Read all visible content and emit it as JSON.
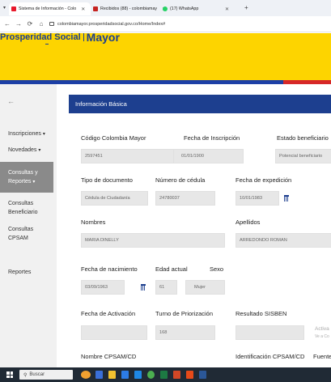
{
  "browser": {
    "tabs": [
      {
        "label": "Sistema de Información - Colo",
        "favicon_color": "#e8192c",
        "active": true
      },
      {
        "label": "Recibidos (88) - colombiamay",
        "favicon_color": "#c5221f",
        "active": false
      },
      {
        "label": "(17) WhatsApp",
        "favicon_color": "#25d366",
        "active": false
      }
    ],
    "tab_close": "✕",
    "new_tab": "+",
    "dropdown": "▾",
    "url": "colombiamayor.prosperidadsocial.gov.co/Home/Index#",
    "nav": {
      "back": "←",
      "forward": "→",
      "reload": "⟳",
      "home": "⌂"
    }
  },
  "header": {
    "brand_sub": "Prosperidad Social",
    "brand_main": "Mayor"
  },
  "sidebar": {
    "items": [
      {
        "label": "Inscripciones",
        "caret": "▾",
        "active": false
      },
      {
        "label": "Novedades",
        "caret": "▾",
        "active": false
      },
      {
        "label": "Consultas y Reportes",
        "caret": "▾",
        "active": true
      }
    ],
    "subitems": [
      {
        "label": "Consultas Beneficiario"
      },
      {
        "label": "Consultas CPSAM"
      },
      {
        "label": "Reportes"
      }
    ]
  },
  "panel": {
    "title": "Información Básica",
    "fields": {
      "codigo": {
        "label": "Código Colombia Mayor",
        "value": "2597451"
      },
      "fecha_inscripcion": {
        "label": "Fecha de Inscripción",
        "value": "01/01/1900"
      },
      "estado": {
        "label": "Estado beneficiario",
        "value": "Potencial beneficiario"
      },
      "tipo_doc": {
        "label": "Tipo de documento",
        "value": "Cédula de Ciudadanía"
      },
      "numero_cedula": {
        "label": "Número de cédula",
        "value": "24780037"
      },
      "fecha_expedicion": {
        "label": "Fecha de expedición",
        "value": "10/01/1983"
      },
      "nombres": {
        "label": "Nombres",
        "value": "MARIA DINELLY"
      },
      "apellidos": {
        "label": "Apellidos",
        "value": "ARREDONDO ROMAN"
      },
      "fecha_nacimiento": {
        "label": "Fecha de nacimiento",
        "value": "03/09/1963"
      },
      "edad": {
        "label": "Edad actual",
        "value": "61"
      },
      "sexo": {
        "label": "Sexo",
        "value": "Mujer"
      },
      "fecha_activacion": {
        "label": "Fecha de Activación",
        "value": ""
      },
      "turno": {
        "label": "Turno de Priorización",
        "value": "168"
      },
      "sisben": {
        "label": "Resultado SISBEN",
        "value": ""
      },
      "nombre_cpsam": {
        "label": "Nombre CPSAM/CD"
      },
      "id_cpsam": {
        "label": "Identificación CPSAM/CD"
      },
      "fuente": {
        "label": "Fuente"
      }
    },
    "faded_right": {
      "line1": "Activa",
      "line2": "Ve a Co"
    }
  },
  "taskbar": {
    "search_placeholder": "Buscar",
    "search_icon": "⚲",
    "icons": [
      {
        "name": "weather-icon",
        "color": "#f0a030"
      },
      {
        "name": "task-view-icon",
        "color": "#3a6fd8"
      },
      {
        "name": "file-explorer-icon",
        "color": "#f2c230"
      },
      {
        "name": "store-icon",
        "color": "#2c7be5"
      },
      {
        "name": "mail-icon",
        "color": "#1e88e5"
      },
      {
        "name": "chrome-icon",
        "color": "#4caf50"
      },
      {
        "name": "excel-icon",
        "color": "#1d7a43"
      },
      {
        "name": "powerpoint-icon",
        "color": "#d24726"
      },
      {
        "name": "photos-icon",
        "color": "#e64a19"
      },
      {
        "name": "word-icon",
        "color": "#2b5797"
      }
    ]
  }
}
